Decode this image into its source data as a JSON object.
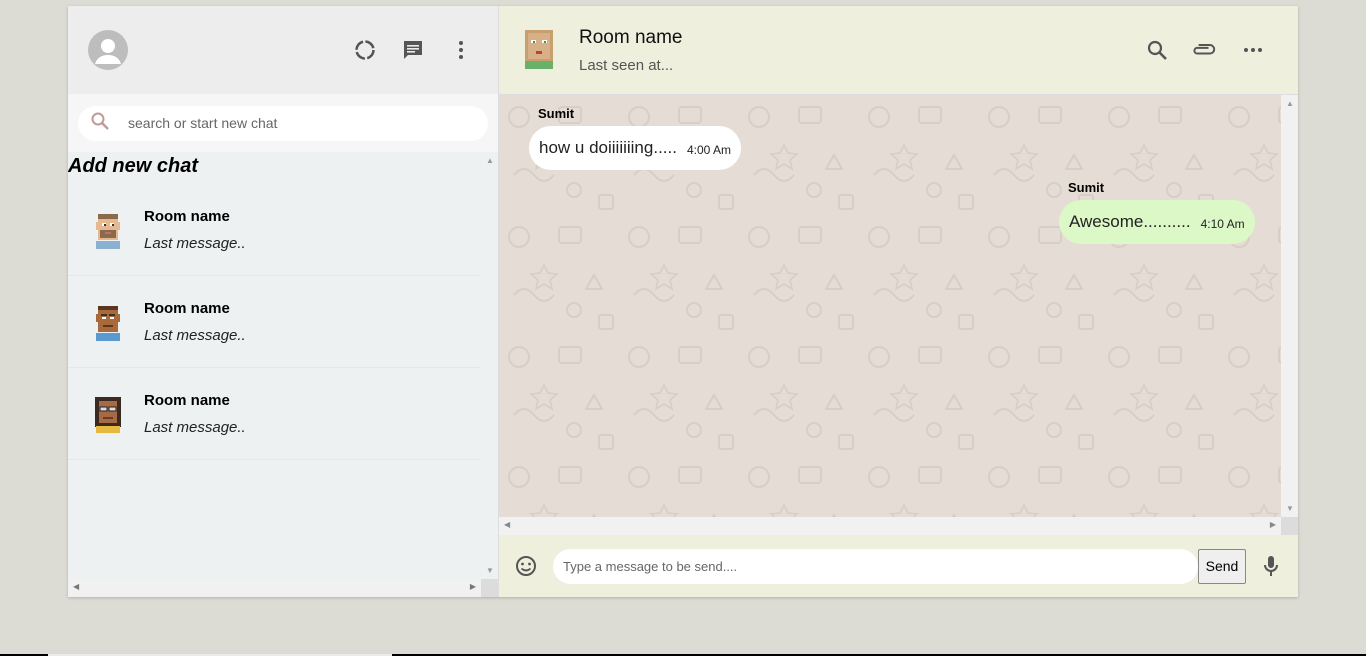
{
  "sidebar": {
    "search_placeholder": "search or start new chat",
    "add_chat_label": "Add new chat",
    "chats": [
      {
        "name": "Room name",
        "last_message": "Last message.."
      },
      {
        "name": "Room name",
        "last_message": "Last message.."
      },
      {
        "name": "Room name",
        "last_message": "Last message.."
      }
    ],
    "icons": [
      "user-avatar-icon",
      "status-ring-icon",
      "chat-icon",
      "more-vert-icon",
      "search-icon"
    ]
  },
  "chat_header": {
    "title": "Room name",
    "subtitle": "Last seen at...",
    "icons": [
      "search-icon",
      "attach-icon",
      "more-horiz-icon"
    ]
  },
  "messages": [
    {
      "sender": "Sumit",
      "text": "how u doiiiiiiing.....",
      "time": "4:00 Am",
      "direction": "incoming"
    },
    {
      "sender": "Sumit",
      "text": "Awesome..........",
      "time": "4:10 Am",
      "direction": "outgoing"
    }
  ],
  "composer": {
    "placeholder": "Type a message to be send....",
    "send_label": "Send",
    "icons": [
      "emoji-icon",
      "mic-icon"
    ]
  },
  "colors": {
    "incoming_bubble": "#ffffff",
    "outgoing_bubble": "#dcf8c6",
    "chat_background": "#e5ddd5",
    "header_background": "#efefde"
  }
}
